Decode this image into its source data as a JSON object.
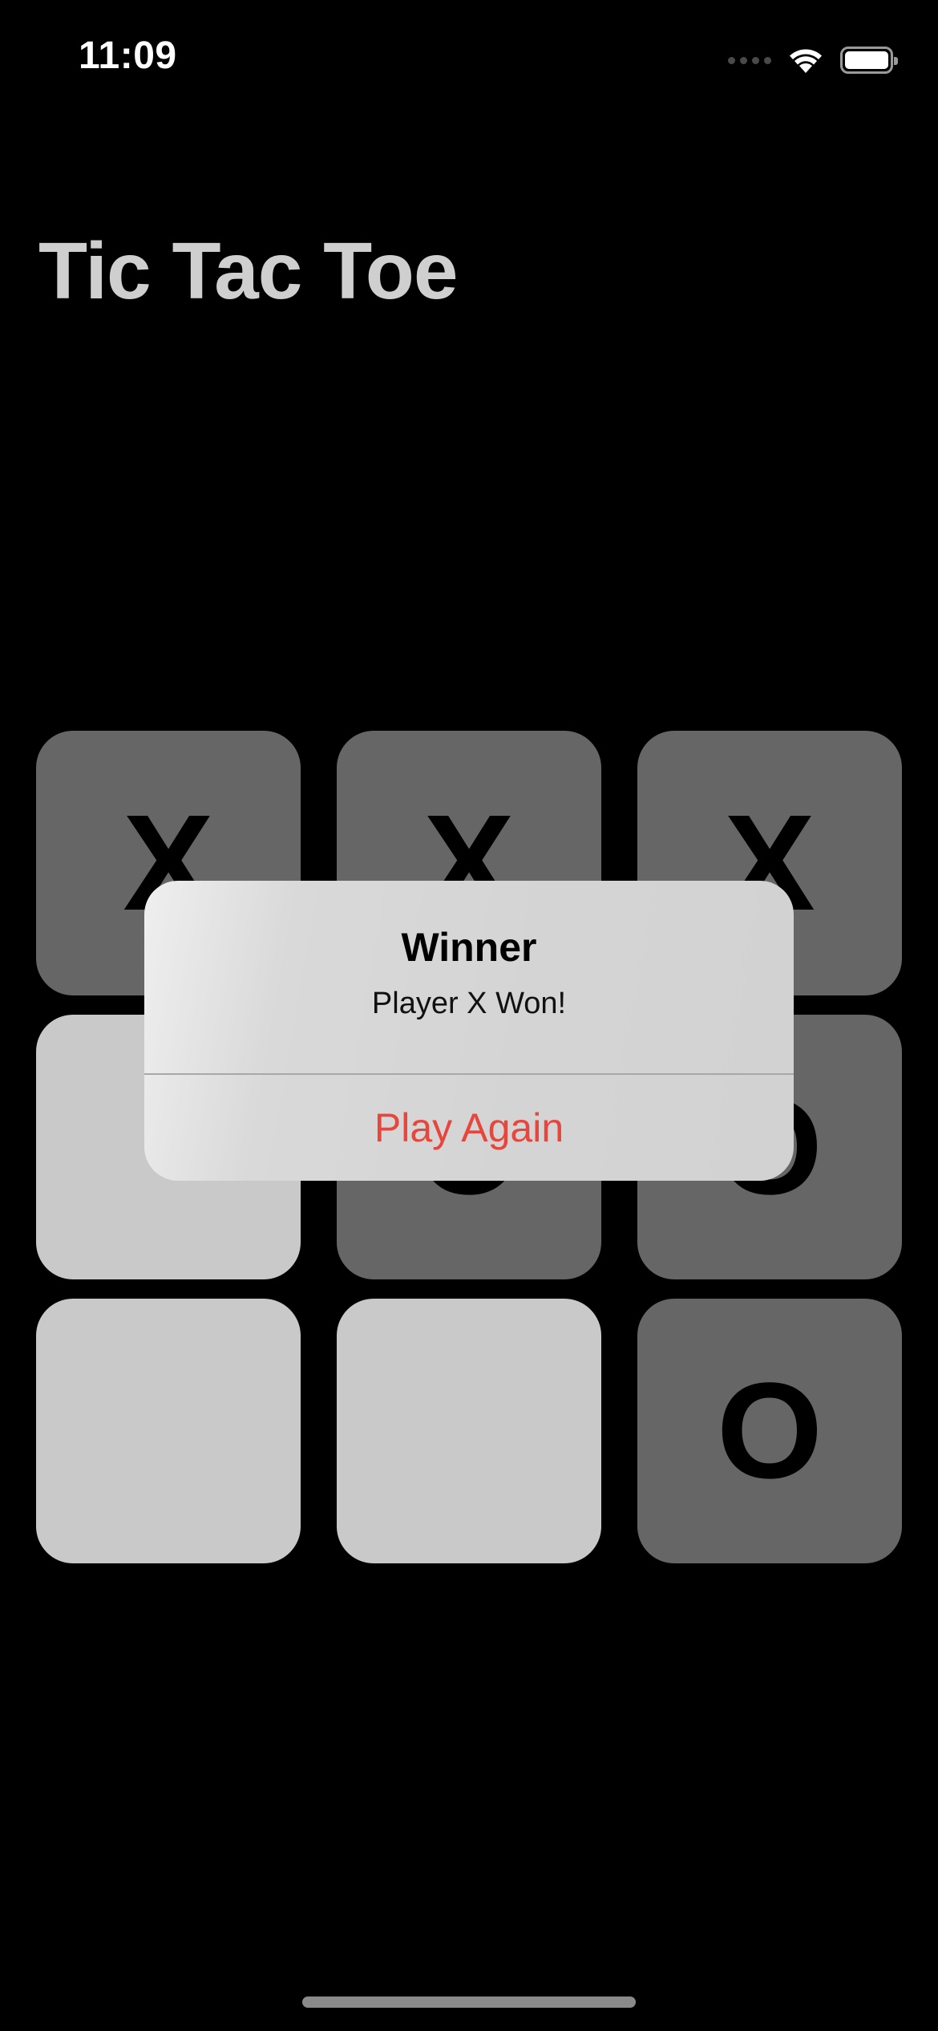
{
  "status_bar": {
    "time": "11:09",
    "signal_icon": "cellular-signal-icon",
    "wifi_icon": "wifi-icon",
    "battery_icon": "battery-icon",
    "battery_level": 1.0
  },
  "header": {
    "title": "Tic Tac Toe"
  },
  "board": {
    "cells": [
      {
        "mark": "X",
        "state": "filled"
      },
      {
        "mark": "X",
        "state": "filled"
      },
      {
        "mark": "X",
        "state": "filled"
      },
      {
        "mark": "",
        "state": "empty"
      },
      {
        "mark": "O",
        "state": "filled"
      },
      {
        "mark": "O",
        "state": "filled"
      },
      {
        "mark": "",
        "state": "empty"
      },
      {
        "mark": "",
        "state": "empty"
      },
      {
        "mark": "O",
        "state": "filled"
      }
    ],
    "filled_color": "#666666",
    "empty_color": "#c9c9c9"
  },
  "alert": {
    "title": "Winner",
    "message": "Player X Won!",
    "action_label": "Play Again",
    "action_color": "#e8453c"
  }
}
